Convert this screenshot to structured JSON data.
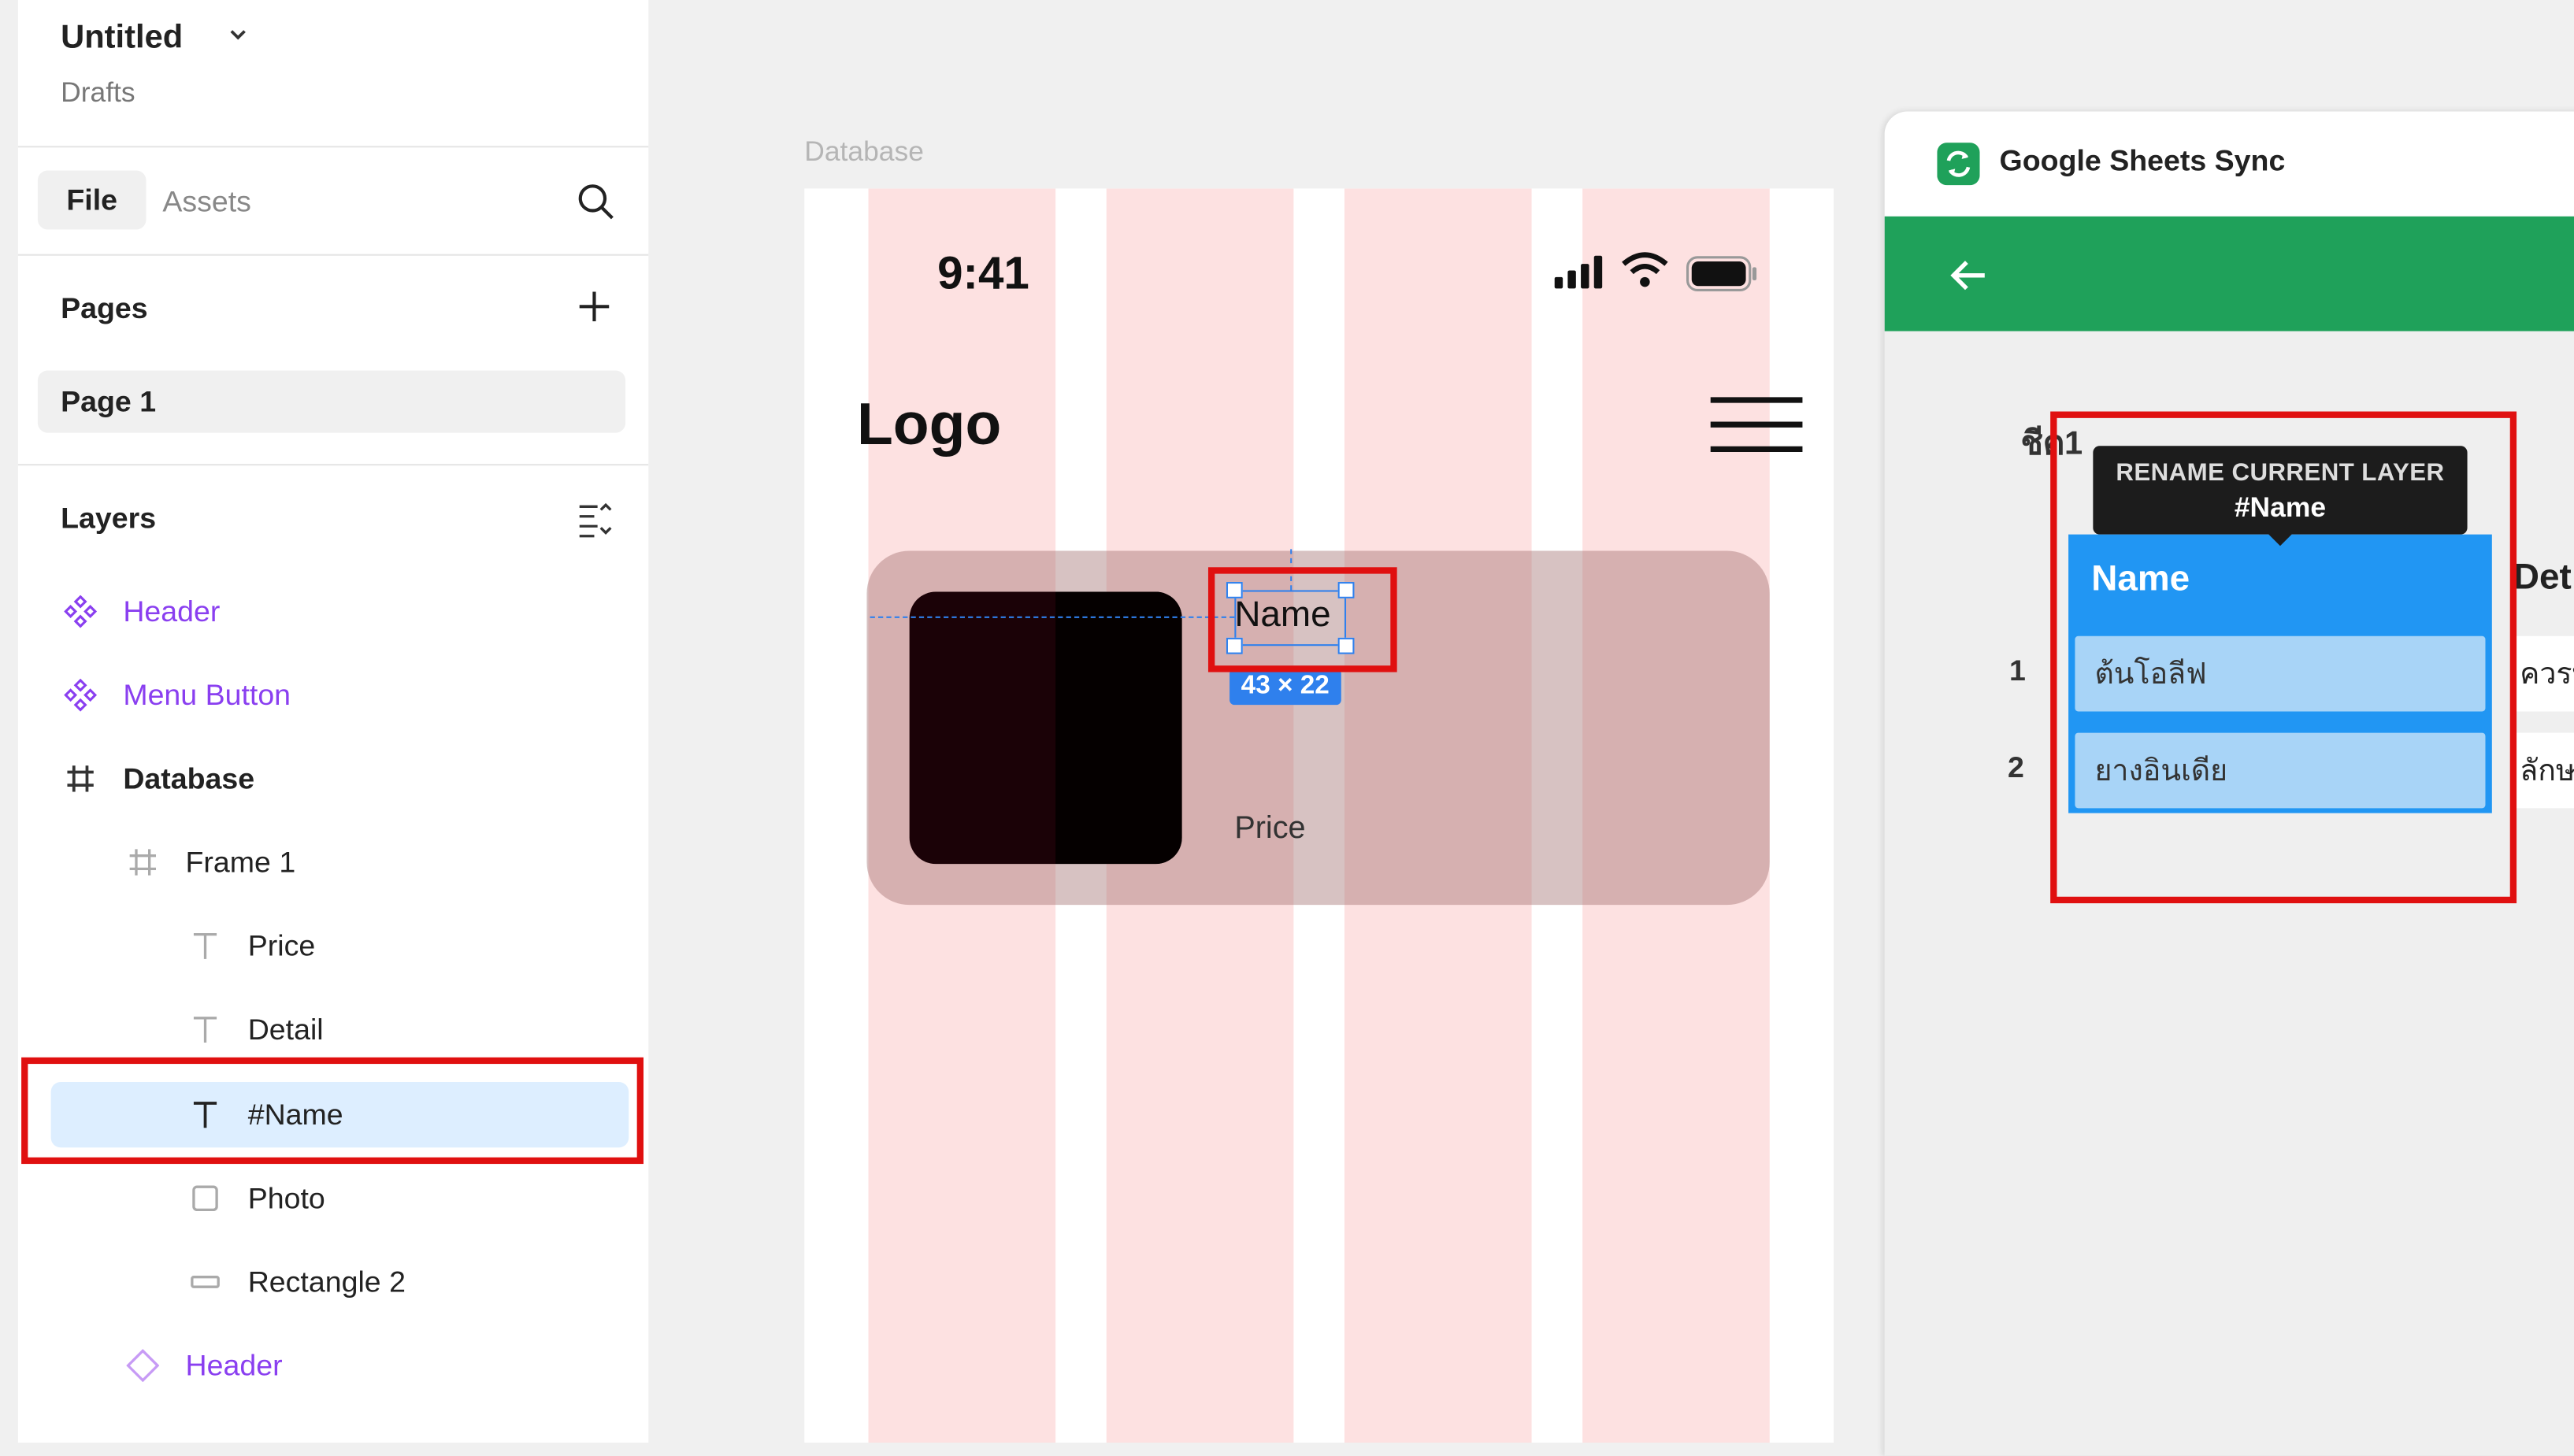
{
  "file": {
    "title": "Untitled",
    "location": "Drafts"
  },
  "tabs": {
    "file": "File",
    "assets": "Assets"
  },
  "pages": {
    "heading": "Pages",
    "items": [
      "Page 1"
    ]
  },
  "layers": {
    "heading": "Layers",
    "items": [
      {
        "name": "Header",
        "type": "component"
      },
      {
        "name": "Menu Button",
        "type": "component"
      },
      {
        "name": "Database",
        "type": "frame"
      },
      {
        "name": "Frame 1",
        "type": "frame"
      },
      {
        "name": "Price",
        "type": "text"
      },
      {
        "name": "Detail",
        "type": "text"
      },
      {
        "name": "#Name",
        "type": "text",
        "selected": true
      },
      {
        "name": "Photo",
        "type": "rectangle"
      },
      {
        "name": "Rectangle 2",
        "type": "rectangle"
      },
      {
        "name": "Header",
        "type": "instance"
      }
    ]
  },
  "canvas": {
    "frame_label": "Database",
    "status_time": "9:41",
    "logo": "Logo",
    "card_name": "Name",
    "card_price": "Price",
    "selection_size": "43 × 22"
  },
  "plugin": {
    "title": "Google Sheets Sync",
    "sheet_tab": "ชีต1",
    "tooltip_line1": "RENAME CURRENT LAYER",
    "tooltip_line2": "#Name",
    "columns": [
      "Name",
      "Det"
    ],
    "rows": [
      {
        "num": "1",
        "name": "ต้นโอลีฟ",
        "detail": "ควรบ"
      },
      {
        "num": "2",
        "name": "ยางอินเดีย",
        "detail": "ลักษ"
      }
    ]
  },
  "colors": {
    "accent_purple": "#8a3ff0",
    "plugin_green": "#1fa15a",
    "highlight_red": "#e01010",
    "selection_blue": "#2f80ed",
    "sheet_blue": "#2196f3"
  }
}
